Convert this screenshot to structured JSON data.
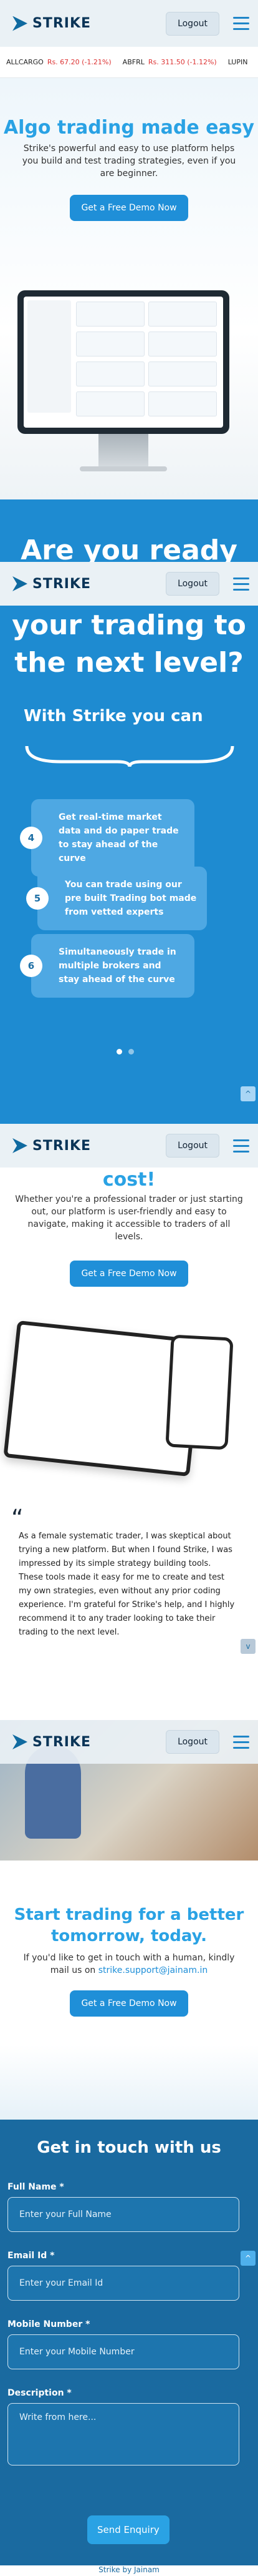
{
  "brand": {
    "name": "STRIKE",
    "login": "Logout"
  },
  "ticker": [
    {
      "symbol": "ALLCARGO",
      "change": "Rs. 67.20 (-1.21%)"
    },
    {
      "symbol": "ABFRL",
      "change": "Rs. 311.50 (-1.12%)"
    },
    {
      "symbol": "LUPIN",
      "change": ""
    }
  ],
  "hero": {
    "title": "Algo trading made easy",
    "subtitle": "Strike's powerful and easy to use platform helps you build and test trading strategies, even if you are beginner.",
    "cta": "Get a Free Demo Now"
  },
  "ready": {
    "line1": "Are you ready",
    "line2": "your trading to",
    "line3": "the next level?",
    "with": "With Strike you can"
  },
  "slides": [
    {
      "num": "4",
      "text": "Get real-time market data and do paper trade to stay ahead of the curve"
    },
    {
      "num": "5",
      "text": "You can trade using our pre built Trading bot made from vetted experts"
    },
    {
      "num": "6",
      "text": "Simultaneously trade in multiple brokers and stay ahead of the curve"
    }
  ],
  "cost": {
    "title": "cost!",
    "text": "Whether you're a professional trader or just starting out, our platform is user-friendly and easy to navigate, making it accessible to traders of all levels.",
    "cta": "Get a Free Demo Now"
  },
  "testimonial": {
    "text": "As a female systematic trader, I was skeptical about trying a new platform. But when I found Strike, I was impressed by its simple strategy building tools. These tools made it easy for me to create and test my own strategies, even without any prior coding experience. I'm grateful for Strike's help, and I highly recommend it to any trader looking to take their trading to the next level."
  },
  "start": {
    "title": "Start trading for a better tomorrow, today.",
    "text": "If you'd like to get in touch with a human, kindly mail us on",
    "email": "strike.support@jainam.in",
    "cta": "Get a Free Demo Now"
  },
  "contact": {
    "title": "Get in touch with us",
    "name_label": "Full Name *",
    "name_ph": "Enter your Full Name",
    "email_label": "Email Id *",
    "email_ph": "Enter your Email Id",
    "mobile_label": "Mobile Number *",
    "mobile_ph": "Enter your Mobile Number",
    "desc_label": "Description *",
    "desc_ph": "Write from here...",
    "send": "Send Enquiry"
  },
  "footer": "Strike by Jainam",
  "colors": {
    "accent": "#2aa2e4",
    "navy": "#0b3558",
    "blue_section": "#1e8bd1",
    "contact_bg": "#1a6aa0"
  }
}
